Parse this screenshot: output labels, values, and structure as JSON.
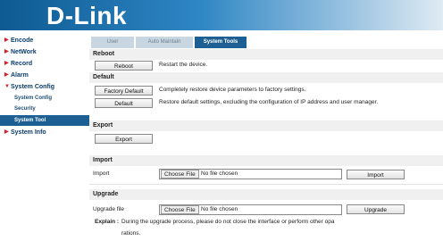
{
  "header": {
    "logo_text": "D-Link"
  },
  "sidebar": {
    "items": [
      {
        "label": "Encode",
        "icon": "triangle-right-icon"
      },
      {
        "label": "NetWork",
        "icon": "triangle-right-icon"
      },
      {
        "label": "Record",
        "icon": "triangle-right-icon"
      },
      {
        "label": "Alarm",
        "icon": "triangle-right-icon"
      },
      {
        "label": "System Config",
        "icon": "triangle-down-icon"
      },
      {
        "label": "System Info",
        "icon": "triangle-right-icon"
      }
    ],
    "subitems": [
      {
        "label": "System Config"
      },
      {
        "label": "Security"
      },
      {
        "label": "System Tool"
      }
    ]
  },
  "tabs": [
    {
      "label": "User"
    },
    {
      "label": "Auto Maintain"
    },
    {
      "label": "System Tools"
    }
  ],
  "reboot": {
    "title": "Reboot",
    "button": "Reboot",
    "desc": "Restart the device."
  },
  "default": {
    "title": "Default",
    "factory_button": "Factory Default",
    "factory_desc": "Completely restore device parameters to factory settings.",
    "default_button": "Default",
    "default_desc": "Restore default settings, excluding the configuration of IP address and user manager."
  },
  "export": {
    "title": "Export",
    "button": "Export"
  },
  "import": {
    "title": "Import",
    "label": "Import",
    "choose": "Choose File",
    "no_file": "No file chosen",
    "button": "Import"
  },
  "upgrade": {
    "title": "Upgrade",
    "label": "Upgrade file",
    "choose": "Choose File",
    "no_file": "No file chosen",
    "button": "Upgrade",
    "explain_label": "Explain :",
    "explain_text": "During the upgrade process, please do not close the interface or perform other opa",
    "explain_text2": "rations."
  },
  "colors": {
    "accent": "#1e5f93",
    "arrow": "#d1222b",
    "header": "#2e86c4"
  }
}
